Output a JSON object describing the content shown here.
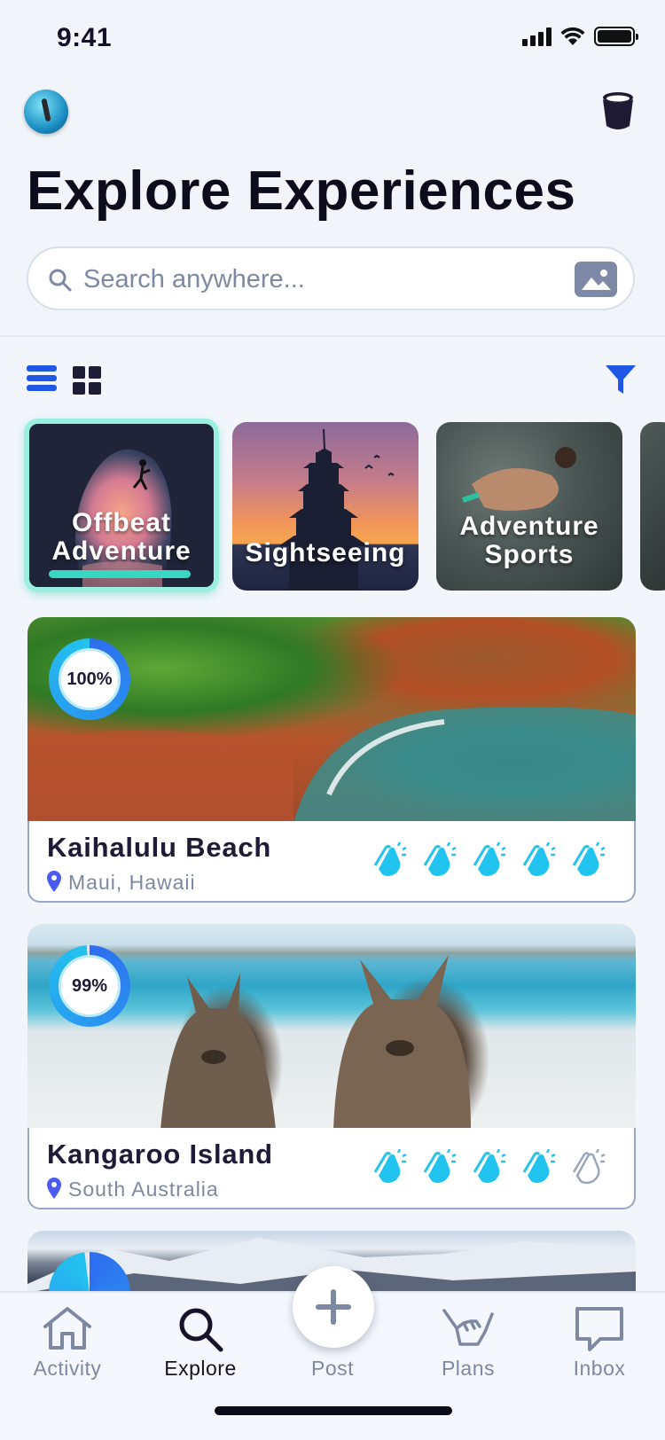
{
  "status_bar": {
    "time": "9:41"
  },
  "header": {
    "title": "Explore Experiences",
    "search_placeholder": "Search anywhere..."
  },
  "categories": [
    {
      "label": "Offbeat Adventure",
      "line1": "Offbeat",
      "line2": "Adventure",
      "selected": true
    },
    {
      "label": "Sightseeing",
      "line1": "Sightseeing",
      "line2": "",
      "selected": false
    },
    {
      "label": "Adventure Sports",
      "line1": "Adventure",
      "line2": "Sports",
      "selected": false
    }
  ],
  "experiences": [
    {
      "name": "Kaihalulu Beach",
      "location": "Maui, Hawaii",
      "match": "100%",
      "match_value": 100,
      "claps_filled": 5,
      "claps_total": 5
    },
    {
      "name": "Kangaroo Island",
      "location": "South Australia",
      "match": "99%",
      "match_value": 99,
      "claps_filled": 4,
      "claps_total": 5
    },
    {
      "name": "",
      "location": "",
      "match": "",
      "match_value": 98,
      "claps_filled": 0,
      "claps_total": 0
    }
  ],
  "tabs": [
    {
      "label": "Activity",
      "icon": "home-icon",
      "active": false
    },
    {
      "label": "Explore",
      "icon": "search-icon",
      "active": true
    },
    {
      "label": "Post",
      "icon": "plus-icon",
      "active": false
    },
    {
      "label": "Plans",
      "icon": "shaka-hand-icon",
      "active": false
    },
    {
      "label": "Inbox",
      "icon": "chat-bubble-icon",
      "active": false
    }
  ],
  "colors": {
    "accent_blue": "#2057e6",
    "clap_active": "#23c3ef",
    "clap_inactive": "#9aa6bd",
    "selected_chip": "#39d6c2",
    "match_ring": "#2e6df0"
  }
}
